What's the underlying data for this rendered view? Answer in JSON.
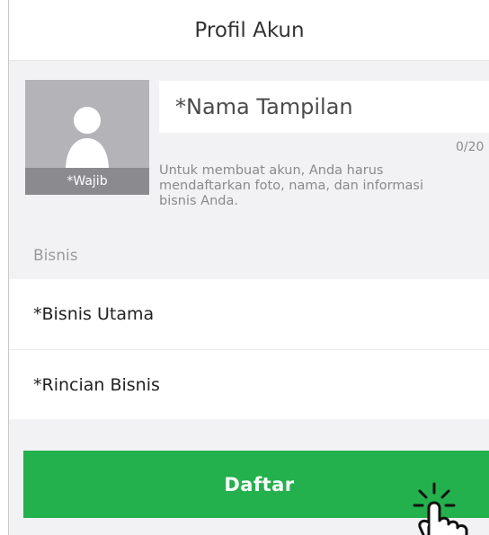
{
  "header": {
    "title": "Profil Akun"
  },
  "profile_photo": {
    "tag": "*Wajib"
  },
  "display_name": {
    "placeholder": "*Nama Tampilan",
    "value": "",
    "counter": "0/20"
  },
  "hint_text": "Untuk membuat akun, Anda harus mendaftarkan foto, nama, dan informasi bisnis Anda.",
  "business": {
    "section_label": "Bisnis",
    "items": [
      {
        "label": "*Bisnis Utama"
      },
      {
        "label": "*Rincian Bisnis"
      }
    ]
  },
  "submit": {
    "label": "Daftar"
  },
  "colors": {
    "accent": "#22b14c",
    "photo_bg": "#b4b4b8",
    "photo_tag": "#8b8b8f"
  },
  "icons": [
    "avatar-silhouette-icon",
    "tap-hand-icon"
  ]
}
